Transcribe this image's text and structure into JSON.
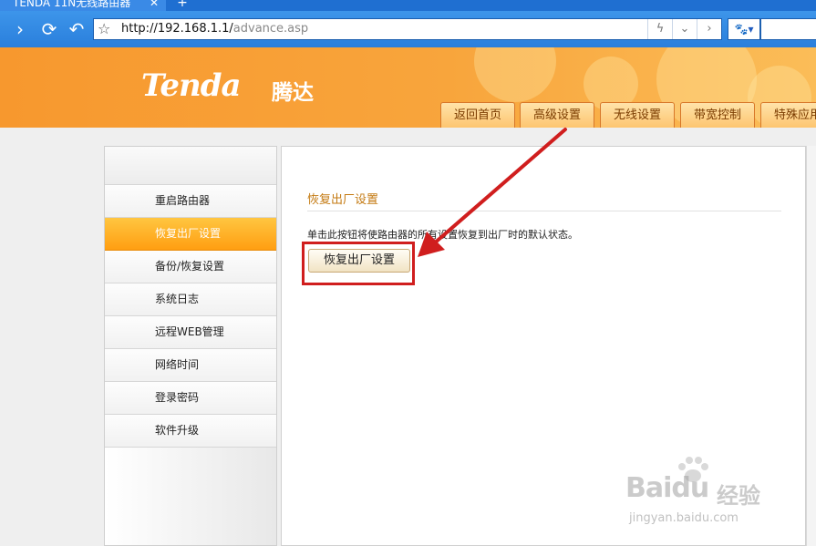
{
  "browser": {
    "tab_title": "TENDA 11N无线路由器",
    "tab_close": "✕",
    "new_tab": "+",
    "url_host": "http://192.168.1.1/",
    "url_path": "advance.asp"
  },
  "header": {
    "logo_text": "Tenda",
    "logo_cn": "腾达",
    "menu": [
      {
        "label": "返回首页"
      },
      {
        "label": "高级设置"
      },
      {
        "label": "无线设置"
      },
      {
        "label": "带宽控制"
      },
      {
        "label": "特殊应用"
      }
    ]
  },
  "sidebar": {
    "items": [
      {
        "label": "重启路由器",
        "active": false
      },
      {
        "label": "恢复出厂设置",
        "active": true
      },
      {
        "label": "备份/恢复设置",
        "active": false
      },
      {
        "label": "系统日志",
        "active": false
      },
      {
        "label": "远程WEB管理",
        "active": false
      },
      {
        "label": "网络时间",
        "active": false
      },
      {
        "label": "登录密码",
        "active": false
      },
      {
        "label": "软件升级",
        "active": false
      }
    ]
  },
  "main": {
    "section_title": "恢复出厂设置",
    "description": "单击此按钮将使路由器的所有设置恢复到出厂时的默认状态。",
    "button_label": "恢复出厂设置"
  },
  "watermark": {
    "brand": "Baidu",
    "brand_cn": "经验",
    "url": "jingyan.baidu.com"
  },
  "colors": {
    "accent_orange": "#f8a53c",
    "active_item": "#ff9e11",
    "annotation_red": "#d01e1e"
  }
}
